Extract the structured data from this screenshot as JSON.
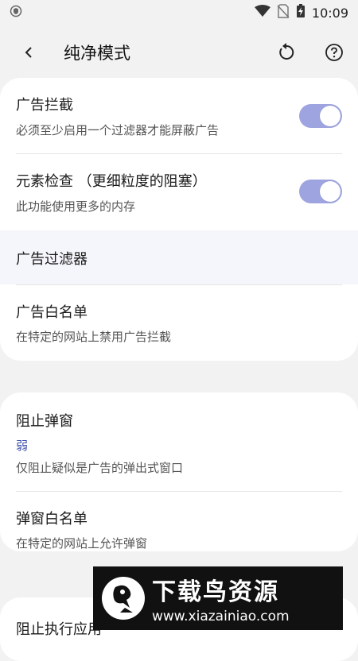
{
  "status": {
    "time": "10:09"
  },
  "header": {
    "title": "纯净模式"
  },
  "adblock": {
    "title": "广告拦截",
    "subtitle": "必须至少启用一个过滤器才能屏蔽广告",
    "enabled": true
  },
  "element_check": {
    "title": "元素检查 （更细粒度的阻塞）",
    "subtitle": "此功能使用更多的内存",
    "enabled": true
  },
  "ad_filters": {
    "title": "广告过滤器"
  },
  "ad_whitelist": {
    "title": "广告白名单",
    "subtitle": "在特定的网站上禁用广告拦截"
  },
  "popup_block": {
    "title": "阻止弹窗",
    "value": "弱",
    "subtitle": "仅阻止疑似是广告的弹出式窗口"
  },
  "popup_whitelist": {
    "title": "弹窗白名单",
    "subtitle": "在特定的网站上允许弹窗"
  },
  "block_apps": {
    "title": "阻止执行应用"
  },
  "watermark": {
    "title": "下载鸟资源",
    "url": "www.xiazainiao.com"
  },
  "colors": {
    "toggle_on": "#9ea4e0",
    "accent_text": "#3b4fa8"
  }
}
